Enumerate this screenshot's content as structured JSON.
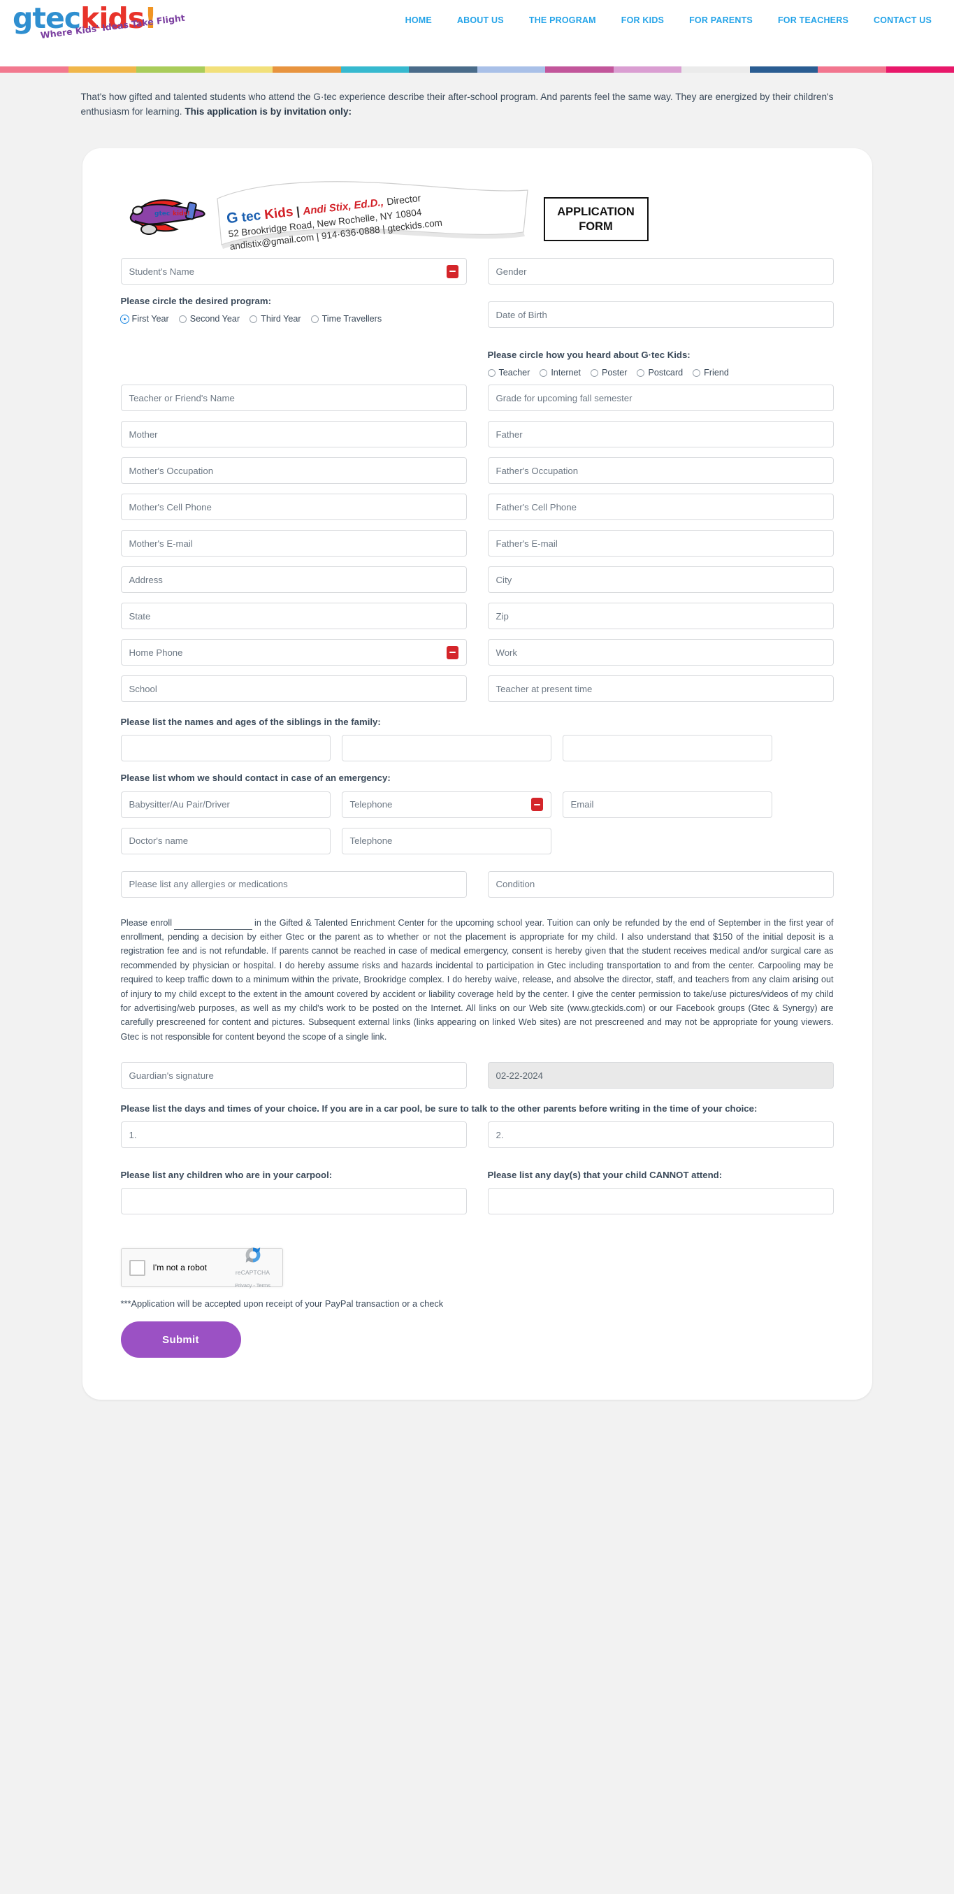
{
  "header": {
    "logo": {
      "word1": "gtec",
      "word2": "kids",
      "bang": "!",
      "tagline": "Where Kids' Ideas Take Flight"
    },
    "nav": [
      {
        "label": "HOME"
      },
      {
        "label": "ABOUT US"
      },
      {
        "label": "THE PROGRAM"
      },
      {
        "label": "FOR KIDS"
      },
      {
        "label": "FOR PARENTS"
      },
      {
        "label": "FOR TEACHERS"
      },
      {
        "label": "CONTACT US"
      }
    ],
    "stripe_colors": [
      "#f2798f",
      "#f0b64a",
      "#a9cc5a",
      "#f2e07a",
      "#e8943f",
      "#36b9cf",
      "#4a6c8a",
      "#a9c0e8",
      "#c2569b",
      "#da9ed2",
      "#ebebeb",
      "#2a5d92",
      "#f2768f",
      "#e8186a"
    ],
    "nav_color": "#23a3e8"
  },
  "intro": {
    "line1": "That's how gifted and talented students who attend the G·tec experience describe their after-school program. And parents feel the",
    "line2": "same way. They are energized by their children's enthusiasm for learning. ",
    "bold": "This application is by invitation only:"
  },
  "letterhead": {
    "plane_badge": "gtec kids!",
    "org_g": "G",
    "org_tec": " tec ",
    "org_kids": "Kids",
    "sep": "|",
    "director_name": "Andi Stix, Ed.D.,",
    "director_title": "Director",
    "address": "52 Brookridge Road, New Rochelle, NY 10804",
    "contact": "andistix@gmail.com   |   914·636·0888   |   gteckids.com",
    "form_box": "APPLICATION FORM"
  },
  "form": {
    "student_name": {
      "placeholder": "Student's Name",
      "value": "",
      "has_lastpass_icon": true
    },
    "gender": {
      "placeholder": "Gender",
      "value": ""
    },
    "date_of_birth": {
      "placeholder": "Date of Birth",
      "value": ""
    },
    "program_label": "Please circle the desired program:",
    "program_options": [
      {
        "label": "First Year",
        "selected": true
      },
      {
        "label": "Second Year",
        "selected": false
      },
      {
        "label": "Third Year",
        "selected": false
      },
      {
        "label": "Time Travellers",
        "selected": false
      }
    ],
    "heard_label": "Please circle how you heard about G·tec Kids:",
    "heard_options": [
      {
        "label": "Teacher",
        "selected": false
      },
      {
        "label": "Internet",
        "selected": false
      },
      {
        "label": "Poster",
        "selected": false
      },
      {
        "label": "Postcard",
        "selected": false
      },
      {
        "label": "Friend",
        "selected": false
      }
    ],
    "teacher_friend_name": {
      "placeholder": "Teacher or Friend's Name",
      "value": ""
    },
    "grade": {
      "placeholder": "Grade for upcoming fall semester",
      "value": ""
    },
    "mother": {
      "placeholder": "Mother",
      "value": ""
    },
    "father": {
      "placeholder": "Father",
      "value": ""
    },
    "mother_occupation": {
      "placeholder": "Mother's Occupation",
      "value": ""
    },
    "father_occupation": {
      "placeholder": "Father's Occupation",
      "value": ""
    },
    "mother_cell": {
      "placeholder": "Mother's Cell Phone",
      "value": ""
    },
    "father_cell": {
      "placeholder": "Father's Cell Phone",
      "value": ""
    },
    "mother_email": {
      "placeholder": "Mother's E-mail",
      "value": ""
    },
    "father_email": {
      "placeholder": "Father's E-mail",
      "value": ""
    },
    "address": {
      "placeholder": "Address",
      "value": ""
    },
    "city": {
      "placeholder": "City",
      "value": ""
    },
    "state": {
      "placeholder": "State",
      "value": ""
    },
    "zip": {
      "placeholder": "Zip",
      "value": ""
    },
    "home_phone": {
      "placeholder": "Home Phone",
      "value": "",
      "has_lastpass_icon": true
    },
    "work": {
      "placeholder": "Work",
      "value": ""
    },
    "school": {
      "placeholder": "School",
      "value": ""
    },
    "teacher_present": {
      "placeholder": "Teacher at present time",
      "value": ""
    },
    "siblings_label": "Please list the names and ages of the siblings in the family:",
    "siblings": [
      {
        "placeholder": "",
        "value": ""
      },
      {
        "placeholder": "",
        "value": ""
      },
      {
        "placeholder": "",
        "value": ""
      }
    ],
    "emergency_label": "Please list whom we should contact in case of an emergency:",
    "babysitter": {
      "placeholder": "Babysitter/Au Pair/Driver",
      "value": ""
    },
    "babysitter_phone": {
      "placeholder": "Telephone",
      "value": "",
      "has_lastpass_icon": true
    },
    "babysitter_email": {
      "placeholder": "Email",
      "value": ""
    },
    "doctor_name": {
      "placeholder": "Doctor's name",
      "value": ""
    },
    "doctor_phone": {
      "placeholder": "Telephone",
      "value": ""
    },
    "allergies": {
      "placeholder": "Please list any allergies or medications",
      "value": ""
    },
    "condition": {
      "placeholder": "Condition",
      "value": ""
    },
    "guardian_signature": {
      "placeholder": "Guardian's signature",
      "value": ""
    },
    "date_field": {
      "value": "02-22-2024",
      "readonly": true
    },
    "days_times_label": "Please list the days and times of your choice. If you are in a car pool, be sure to talk to the other parents before writing in the time of your choice:",
    "choice_1": {
      "placeholder": "1.",
      "value": ""
    },
    "choice_2": {
      "placeholder": "2.",
      "value": ""
    },
    "carpool_label": "Please list any children who are in your carpool:",
    "cannot_attend_label": "Please list any day(s) that your child CANNOT attend:",
    "carpool_field": {
      "placeholder": "",
      "value": ""
    },
    "cannot_attend_field": {
      "placeholder": "",
      "value": ""
    }
  },
  "legal": {
    "lead": "Please enroll",
    "body": "in the Gifted & Talented Enrichment Center for the upcoming school year. Tuition can only be refunded by the end of September in the first year of enrollment, pending a decision by either Gtec or the parent as to whether or not the placement is appropriate for my child. I also understand that $150 of the initial deposit is a registration fee and is not refundable. If parents cannot be reached in case of medical emergency, consent is hereby given that the student receives medical and/or surgical care as recommended by physician or hospital. I do hereby assume risks and hazards incidental to participation in Gtec including transportation to and from the center. Carpooling may be required to keep traffic down to a minimum within the private, Brookridge complex. I do hereby waive, release, and absolve the director, staff, and teachers from any claim arising out of injury to my child except to the extent in the amount covered by accident or liability coverage held by the center. I give the center permission to take/use pictures/videos of my child for advertising/web purposes, as well as my child's work to be posted on the Internet. All links on our Web site (www.gteckids.com) or our Facebook groups (Gtec & Synergy) are carefully prescreened for content and pictures. Subsequent external links (links appearing on linked Web sites) are not prescreened and may not be appropriate for young viewers. Gtec is not responsible for content beyond the scope of a single link."
  },
  "captcha": {
    "label": "I'm not a robot",
    "brand": "reCAPTCHA",
    "links": "Privacy - Terms",
    "checked": false
  },
  "footer": {
    "note": "***Application will be accepted upon receipt of your PayPal transaction or a check",
    "submit_label": "Submit",
    "submit_color": "#9b51c4"
  }
}
